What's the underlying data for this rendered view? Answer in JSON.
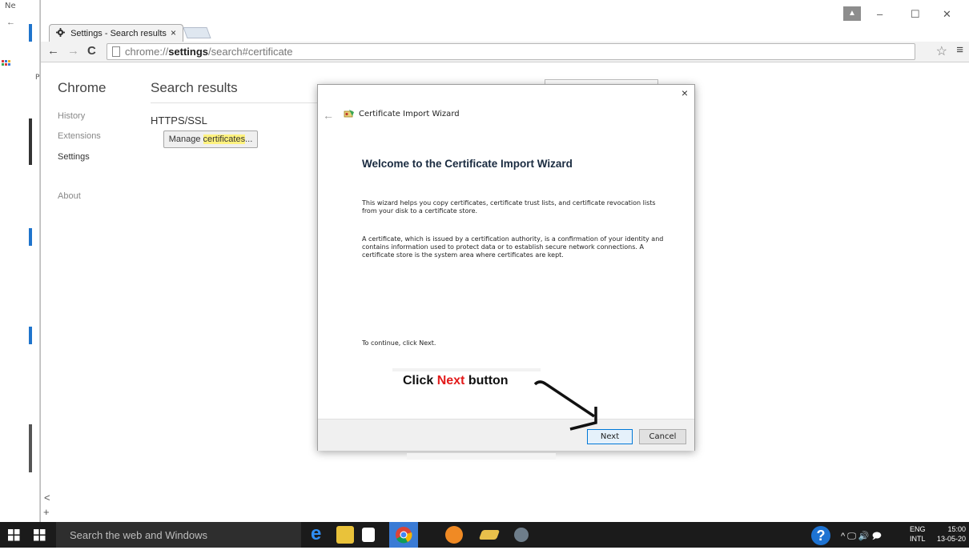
{
  "background_window": {
    "fragment_top": "Ne",
    "fragment_side": "P"
  },
  "chrome": {
    "tab": {
      "title": "Settings - Search results",
      "close": "×"
    },
    "window_controls": {
      "user": "▲",
      "minimize": "–",
      "maximize": "☐",
      "close": "✕"
    },
    "toolbar": {
      "back": "←",
      "forward": "→",
      "reload": "C",
      "url_prefix": "chrome://",
      "url_host": "settings",
      "url_path": "/search#certificate",
      "star": "☆",
      "menu": "≡"
    }
  },
  "settings": {
    "nav_title": "Chrome",
    "nav_items": [
      "History",
      "Extensions",
      "Settings",
      "About"
    ],
    "page_title": "Search results",
    "section_title": "HTTPS/SSL",
    "manage_button": {
      "prefix": "Manage ",
      "highlight": "certificates",
      "suffix": "..."
    },
    "scroll_left": "<",
    "scroll_move": "+"
  },
  "dialog": {
    "close": "×",
    "back": "←",
    "title": "Certificate Import Wizard",
    "heading": "Welcome to the Certificate Import Wizard",
    "paragraph1": "This wizard helps you copy certificates, certificate trust lists, and certificate revocation lists from your disk to a certificate store.",
    "paragraph2": "A certificate, which is issued by a certification authority, is a confirmation of your identity and contains information used to protect data or to establish secure network connections. A certificate store is the system area where certificates are kept.",
    "continue_text": "To continue, click Next.",
    "next_button": "Next",
    "cancel_button": "Cancel"
  },
  "annotation": {
    "prefix": "Click ",
    "highlight": "Next",
    "suffix": " button",
    "highlight_color": "#e31b1b"
  },
  "taskbar": {
    "search_placeholder": "Search the web and Windows",
    "tray_icons": "^ 🖵 🔊 🗩",
    "lang_line1": "ENG",
    "lang_line2": "INTL",
    "time": "15:00",
    "date": "13-05-20"
  }
}
